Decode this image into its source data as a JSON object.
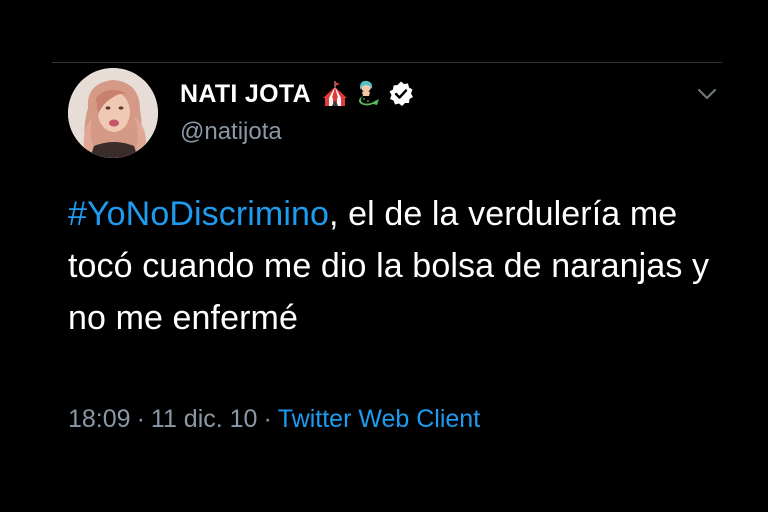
{
  "tweet": {
    "display_name": "NATI JOTA",
    "name_emojis": [
      "circus-tent-icon",
      "mermaid-icon"
    ],
    "verified": true,
    "handle": "@natijota",
    "hashtag": "#YoNoDiscrimino",
    "text_rest": ", el de la verdulería me tocó cuando me dio la bolsa de naranjas y no me enfermé",
    "time": "18:09",
    "separator": "·",
    "date": "11 dic. 10",
    "client": "Twitter Web Client"
  },
  "colors": {
    "background": "#000000",
    "text": "#ffffff",
    "secondary": "#8b98a5",
    "link": "#1d9bf0",
    "divider": "#2f3336"
  }
}
